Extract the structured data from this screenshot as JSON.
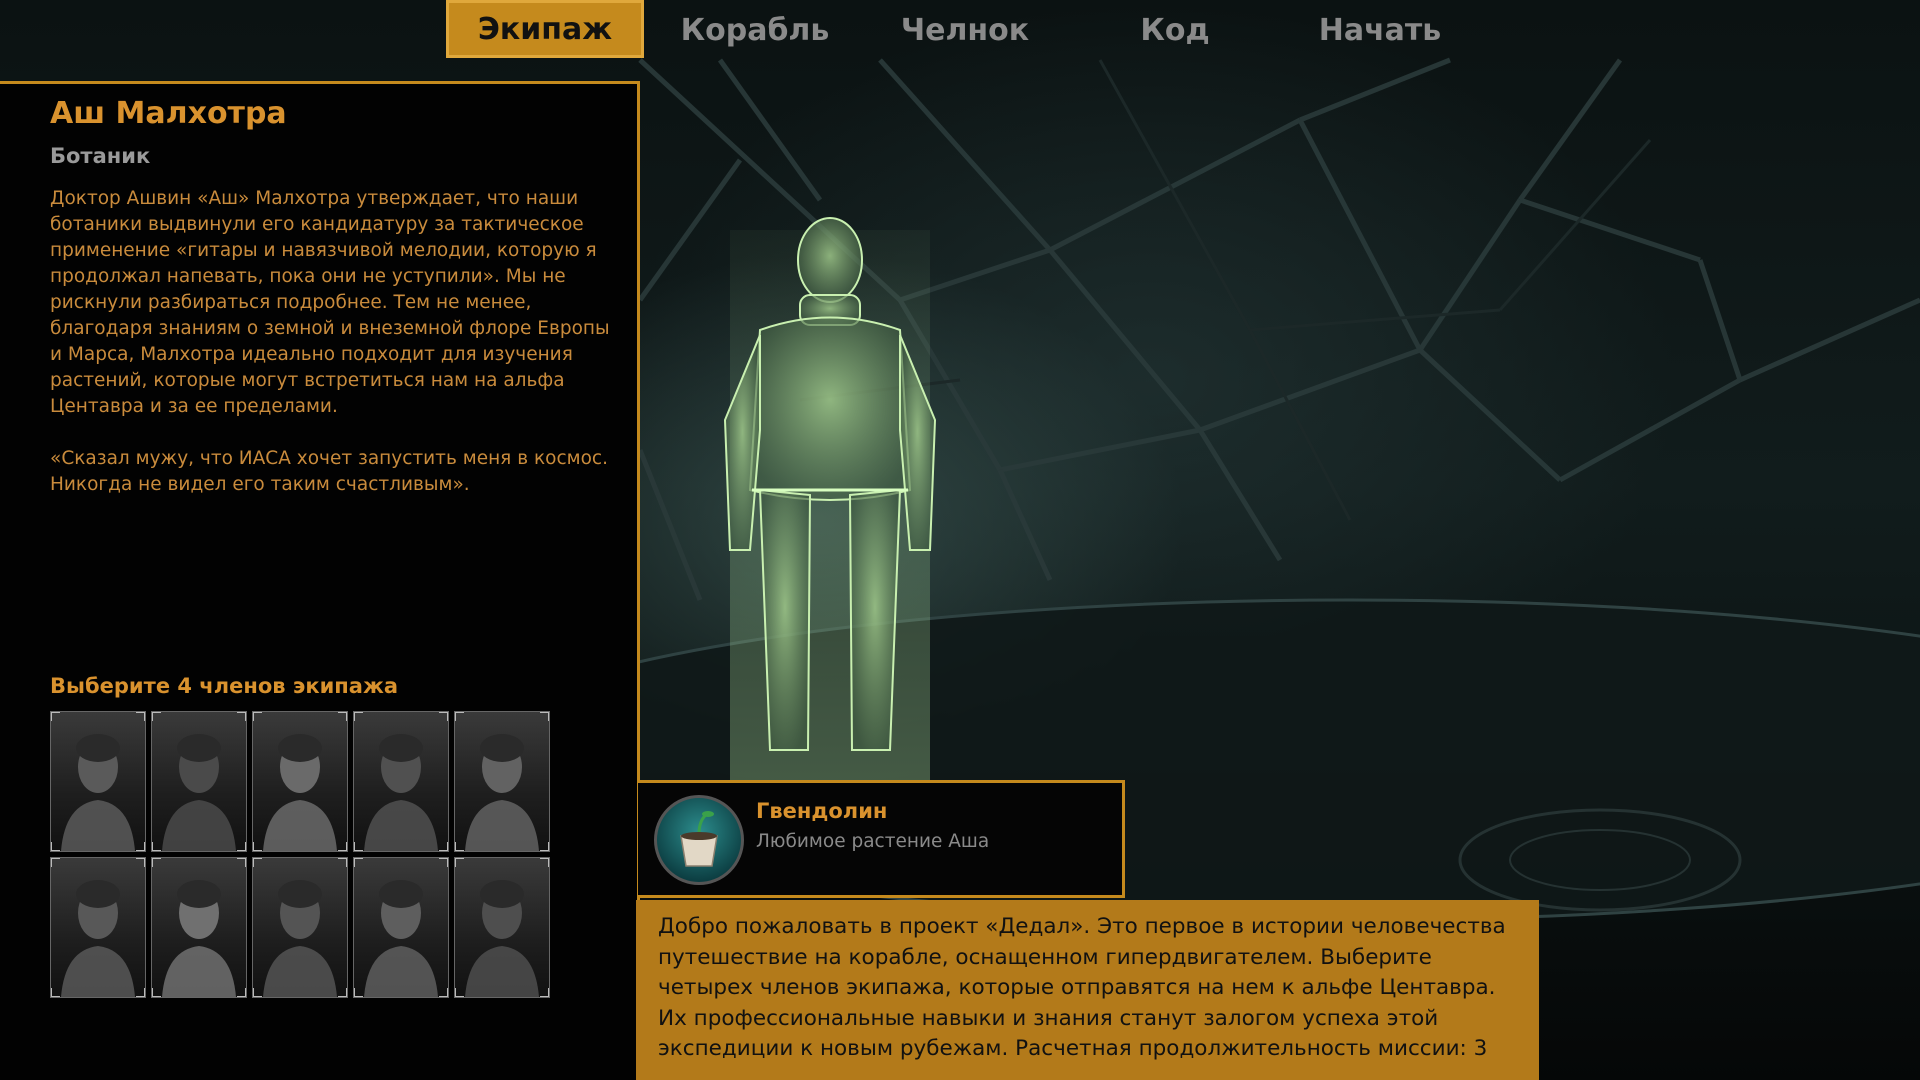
{
  "tabs": [
    {
      "label": "Экипаж",
      "active": true
    },
    {
      "label": "Корабль",
      "active": false
    },
    {
      "label": "Челнок",
      "active": false
    },
    {
      "label": "Код",
      "active": false
    },
    {
      "label": "Начать",
      "active": false
    }
  ],
  "character": {
    "name": "Аш Малхотра",
    "role": "Ботаник",
    "bio": "Доктор Ашвин «Аш» Малхотра утверждает, что наши ботаники выдвинули его кандидатуру за тактическое применение «гитары и навязчивой мелодии, которую я продолжал напевать, пока они не уступили». Мы не рискнули разбираться подробнее. Тем не менее, благодаря знаниям о земной и внеземной флоре Европы и Марса, Малхотра идеально подходит для изучения растений, которые могут встретиться нам на альфа Центавра и за ее пределами.",
    "quote": "«Сказал мужу, что ИАСА хочет запустить меня в космос. Никогда не видел его таким счастливым»."
  },
  "crew_select": {
    "title": "Выберите 4 членов экипажа",
    "portraits": [
      "crew-1",
      "crew-2",
      "crew-3",
      "crew-4",
      "crew-5",
      "crew-6",
      "crew-7",
      "crew-8",
      "crew-9",
      "crew-10"
    ]
  },
  "item": {
    "name": "Гвендолин",
    "description": "Любимое растение Аша",
    "icon": "potted-plant-icon"
  },
  "welcome": {
    "text": "Добро пожаловать в проект «Дедал». Это первое в истории человечества путешествие на корабле, оснащенном гипердвигателем. Выберите четырех членов экипажа, которые отправятся на нем к альфе Центавра. Их профессиональные навыки и знания станут залогом успеха этой экспедиции к новым рубежам. Расчетная продолжительность миссии: 3"
  },
  "colors": {
    "accent": "#c58a1d",
    "text_orange": "#d9922e",
    "hologram": "#b8e0a0"
  }
}
